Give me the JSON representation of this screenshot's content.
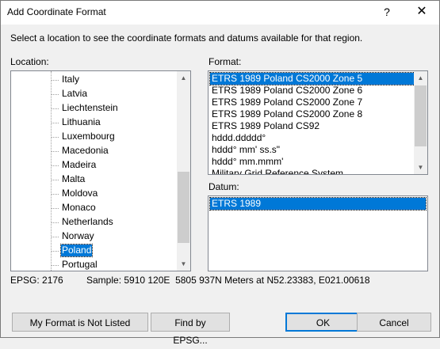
{
  "window": {
    "title": "Add Coordinate Format",
    "help": "?",
    "close": "✕"
  },
  "instruction": "Select a location to see the coordinate formats and datums available for that region.",
  "location": {
    "label": "Location:",
    "items": [
      "Italy",
      "Latvia",
      "Liechtenstein",
      "Lithuania",
      "Luxembourg",
      "Macedonia",
      "Madeira",
      "Malta",
      "Moldova",
      "Monaco",
      "Netherlands",
      "Norway",
      "Poland",
      "Portugal"
    ],
    "selected": "Poland"
  },
  "format": {
    "label": "Format:",
    "items": [
      "ETRS 1989 Poland CS2000 Zone 5",
      "ETRS 1989 Poland CS2000 Zone 6",
      "ETRS 1989 Poland CS2000 Zone 7",
      "ETRS 1989 Poland CS2000 Zone 8",
      "ETRS 1989 Poland CS92",
      "hddd.ddddd°",
      "hddd° mm' ss.s\"",
      "hddd° mm.mmm'",
      "Military Grid Reference System"
    ],
    "selected": "ETRS 1989 Poland CS2000 Zone 5"
  },
  "datum": {
    "label": "Datum:",
    "items": [
      "ETRS 1989"
    ],
    "selected": "ETRS 1989"
  },
  "info": {
    "epsg": "EPSG: 2176",
    "sample": "Sample: 5910 120E  5805 937N Meters at N52.23383, E021.00618"
  },
  "buttons": {
    "not_listed": "My Format is Not Listed",
    "find_epsg": "Find by EPSG...",
    "ok": "OK",
    "cancel": "Cancel"
  }
}
